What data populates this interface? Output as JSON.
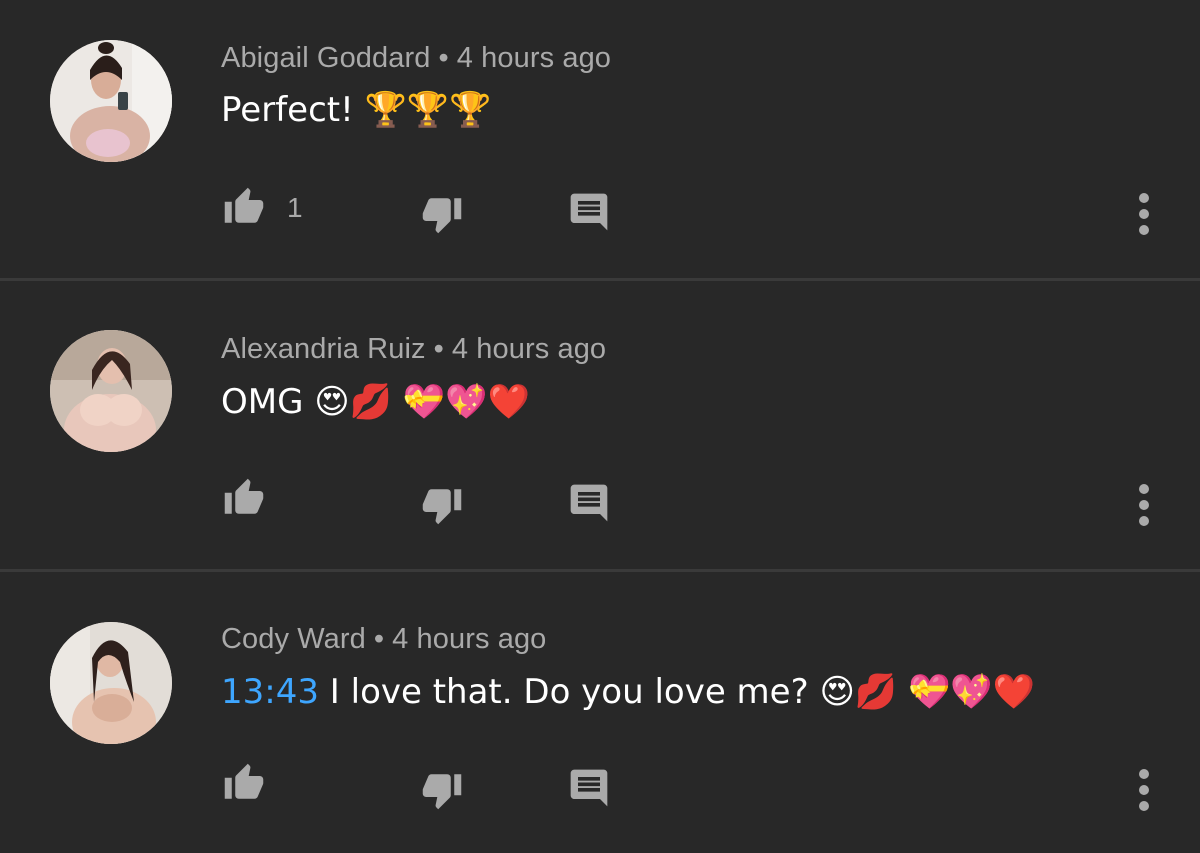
{
  "comments": [
    {
      "author": "Abigail Goddard",
      "separator": "•",
      "time": "4 hours ago",
      "timestamp_link": "",
      "text": "Perfect! 🏆🏆🏆",
      "like_count": "1",
      "avatar_bg": "#e9e4df"
    },
    {
      "author": "Alexandria Ruiz",
      "separator": "•",
      "time": "4 hours ago",
      "timestamp_link": "",
      "text": "OMG 😍💋 💝💖❤️",
      "like_count": "",
      "avatar_bg": "#cdbfb3"
    },
    {
      "author": "Cody Ward",
      "separator": "•",
      "time": "4 hours ago",
      "timestamp_link": "13:43",
      "text": " I love that. Do you love me? 😍💋 💝💖❤️",
      "like_count": "",
      "avatar_bg": "#dcd8d3"
    }
  ],
  "icons": {
    "like": "thumb-up-icon",
    "dislike": "thumb-down-icon",
    "reply": "comment-icon",
    "more": "more-vertical-icon"
  },
  "colors": {
    "background": "#282828",
    "meta_text": "#aaaaaa",
    "icon": "#aaaaaa",
    "link": "#3ea6ff",
    "divider": "#3a3a3a"
  }
}
